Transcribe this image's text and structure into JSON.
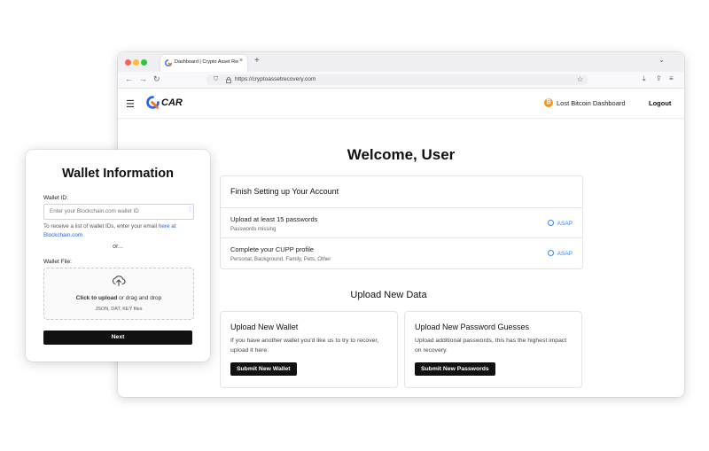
{
  "browser": {
    "tab_title": "Dashboard | Crypto Asset Reco",
    "tab_close": "×",
    "new_tab": "+",
    "url": "https://cryptoassetrecovery.com"
  },
  "header": {
    "logo_text": "CAR",
    "btc_symbol": "₿",
    "lost_bitcoin_label": "Lost Bitcoin Dashboard",
    "logout_label": "Logout"
  },
  "main": {
    "welcome": "Welcome, User",
    "setup": {
      "title": "Finish Setting up Your Account",
      "items": [
        {
          "title": "Upload at least 15 passwords",
          "subtitle": "Passwords missing",
          "badge": "ASAP"
        },
        {
          "title": "Complete your CUPP profile",
          "subtitle": "Personal, Background, Family, Pets, Other",
          "badge": "ASAP"
        }
      ]
    },
    "upload_heading": "Upload New Data",
    "upload_wallet": {
      "title": "Upload New Wallet",
      "description": "If you have another wallet you'd like us to try to recover, upload it here.",
      "button": "Submit New Wallet"
    },
    "upload_passwords": {
      "title": "Upload New Password Guesses",
      "description": "Upload additional passwords, this has the highest impact on recovery.",
      "button": "Submit New Passwords"
    }
  },
  "modal": {
    "title": "Wallet Information",
    "wallet_id_label": "Wallet ID:",
    "wallet_id_placeholder": "Enter your Blockchain.com wallet ID",
    "help_text": "To receive a list of wallet IDs, enter your email ",
    "help_link": "here at Blockchain.com",
    "or_text": "or...",
    "wallet_file_label": "Wallet File:",
    "dropzone_click": "Click to upload",
    "dropzone_text": " or drag and drop",
    "dropzone_types": "JSON, DAT, KEY files",
    "next_button": "Next"
  },
  "colors": {
    "accent": "#2563eb",
    "bitcoin": "#f7931a",
    "button": "#111111"
  }
}
